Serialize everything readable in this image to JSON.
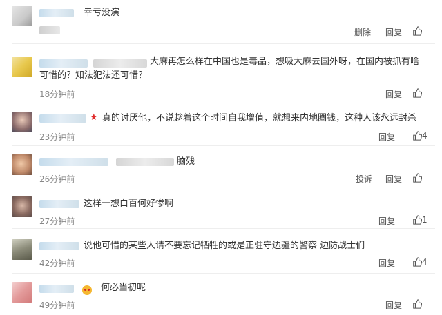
{
  "comments": [
    {
      "text": "幸亏没演",
      "actions": [
        "删除",
        "回复"
      ],
      "time": "",
      "likes": ""
    },
    {
      "text": "大麻再怎么样在中国也是毒品，想吸大麻去国外呀，在国内被抓有啥可惜的？知法犯法还可惜？",
      "time": "18分钟前",
      "actions": [
        "回复"
      ],
      "likes": ""
    },
    {
      "text": "真的讨厌他，不说趁着这个时间自我增值，就想来内地圈钱，这种人该永远封杀",
      "time": "23分钟前",
      "actions": [
        "回复"
      ],
      "likes": "4"
    },
    {
      "text": "脑残",
      "time": "26分钟前",
      "actions": [
        "投诉",
        "回复"
      ],
      "likes": ""
    },
    {
      "text": "这样一想白百何好惨啊",
      "time": "27分钟前",
      "actions": [
        "回复"
      ],
      "likes": "1"
    },
    {
      "text": "说他可惜的某些人请不要忘记牺牲的或是正驻守边疆的警察 边防战士们",
      "time": "42分钟前",
      "actions": [
        "回复"
      ],
      "likes": "4"
    },
    {
      "text": "何必当初呢",
      "time": "49分钟前",
      "actions": [
        "回复"
      ],
      "likes": ""
    }
  ],
  "icons": {
    "like": "thumbs-up-icon",
    "vip": "star-icon",
    "emoji": "smile-emoji-icon"
  },
  "colors": {
    "name_blur": "#c5dcec",
    "time": "#888888",
    "vip_star": "#e02a2a"
  }
}
